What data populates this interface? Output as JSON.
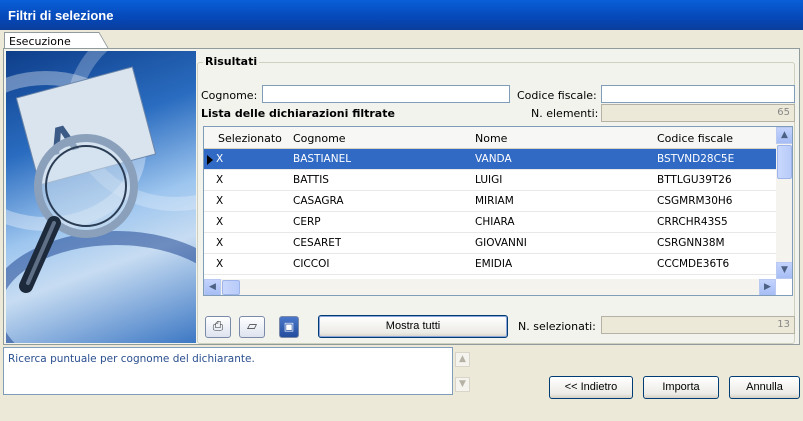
{
  "window": {
    "title": "Filtri di selezione"
  },
  "tabs": [
    {
      "label": "Esecuzione"
    }
  ],
  "results": {
    "group_label": "Risultati",
    "cognome_label": "Cognome:",
    "cognome_value": "",
    "codice_fiscale_label": "Codice fiscale:",
    "codice_fiscale_value": "",
    "list_title": "Lista delle dichiarazioni filtrate",
    "n_elementi_label": "N. elementi:",
    "n_elementi_value": "65"
  },
  "table": {
    "columns": [
      "Selezionato",
      "Cognome",
      "Nome",
      "Codice fiscale"
    ],
    "rows": [
      {
        "sel": "X",
        "cognome": "BASTIANEL",
        "nome": "VANDA",
        "cf": "BSTVND28C5E"
      },
      {
        "sel": "X",
        "cognome": "BATTIS",
        "nome": "LUIGI",
        "cf": "BTTLGU39T26"
      },
      {
        "sel": "X",
        "cognome": "CASAGRA",
        "nome": "MIRIAM",
        "cf": "CSGMRM30H6"
      },
      {
        "sel": "X",
        "cognome": "CERP",
        "nome": "CHIARA",
        "cf": "CRRCHR43S5"
      },
      {
        "sel": "X",
        "cognome": "CESARET",
        "nome": "GIOVANNI",
        "cf": "CSRGNN38M"
      },
      {
        "sel": "X",
        "cognome": "CICCOI",
        "nome": "EMIDIA",
        "cf": "CCCMDE36T6"
      }
    ]
  },
  "actions": {
    "show_all_label": "Mostra tutti",
    "n_selezionati_label": "N. selezionati:",
    "n_selezionati_value": "13"
  },
  "status": {
    "text": "Ricerca puntuale per cognome del dichiarante."
  },
  "footer": {
    "back_label": "<< Indietro",
    "import_label": "Importa",
    "cancel_label": "Annulla"
  },
  "icons": [
    "print-icon",
    "filter-icon",
    "save-icon",
    "magnifier-illustration"
  ]
}
